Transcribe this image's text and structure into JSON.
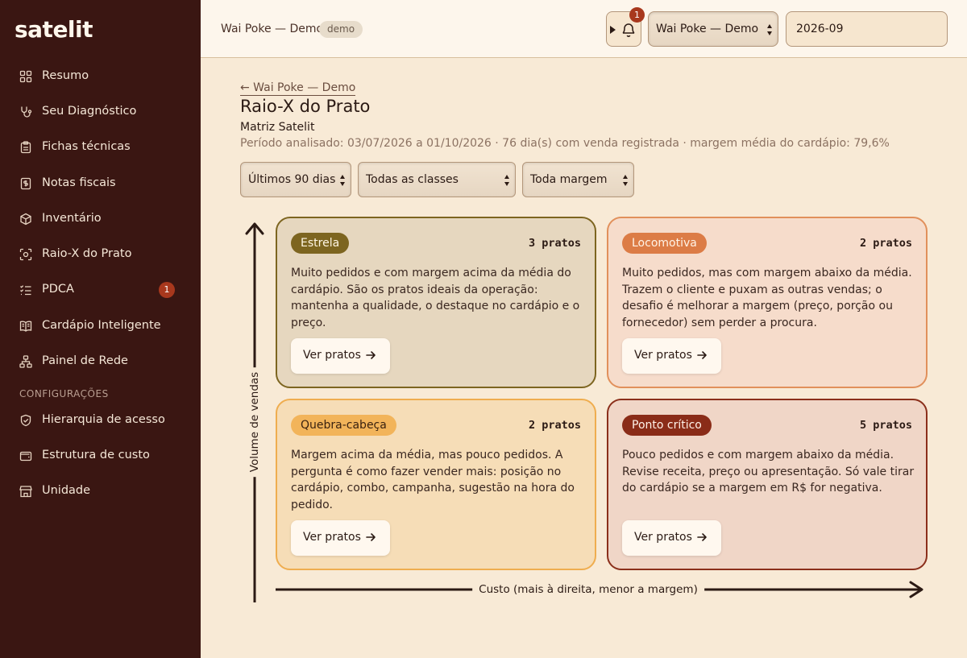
{
  "app": {
    "logo": "satelit"
  },
  "sidebar": {
    "items": [
      {
        "label": "Resumo",
        "icon": "grid-icon"
      },
      {
        "label": "Seu Diagnóstico",
        "icon": "stethoscope-icon"
      },
      {
        "label": "Fichas técnicas",
        "icon": "clipboard-icon"
      },
      {
        "label": "Notas fiscais",
        "icon": "receipt-icon"
      },
      {
        "label": "Inventário",
        "icon": "box-icon"
      },
      {
        "label": "Raio-X do Prato",
        "icon": "scan-icon"
      },
      {
        "label": "PDCA",
        "icon": "checklist-icon",
        "badge": "1"
      },
      {
        "label": "Cardápio Inteligente",
        "icon": "book-icon"
      },
      {
        "label": "Painel de Rede",
        "icon": "network-icon"
      }
    ],
    "section_label": "CONFIGURAÇÕES",
    "config_items": [
      {
        "label": "Hierarquia de acesso",
        "icon": "shield-icon"
      },
      {
        "label": "Estrutura de custo",
        "icon": "wallet-icon"
      },
      {
        "label": "Unidade",
        "icon": "store-icon"
      }
    ]
  },
  "topbar": {
    "org_name": "Wai Poke — Demo",
    "badge": "demo",
    "notification_count": "1",
    "org_select_value": "Wai Poke — Demo",
    "month_value": "2026-09"
  },
  "main": {
    "back_link": "← Wai Poke — Demo",
    "title": "Raio-X do Prato",
    "subtitle": "Matriz Satelit",
    "period": "Período analisado: 03/07/2026 a 01/10/2026 · 76 dia(s) com venda registrada · margem média do cardápio: 79,6%",
    "filters": {
      "period": "Últimos 90 dias",
      "class": "Todas as classes",
      "margin": "Toda margem"
    },
    "axes": {
      "y_label": "Volume de vendas",
      "x_label": "Custo (mais à direita, menor a margem)"
    },
    "quadrants": {
      "estrela": {
        "name": "Estrela",
        "count": "3 pratos",
        "description": "Muito pedidos e com margem acima da média do cardápio. São os pratos ideais da operação: mantenha a qualidade, o destaque no cardápio e o preço.",
        "button": "Ver pratos"
      },
      "locomotiva": {
        "name": "Locomotiva",
        "count": "2 pratos",
        "description": "Muito pedidos, mas com margem abaixo da média. Trazem o cliente e puxam as outras vendas; o desafio é melhorar a margem (preço, porção ou fornecedor) sem perder a procura.",
        "button": "Ver pratos"
      },
      "quebra_cabeca": {
        "name": "Quebra-cabeça",
        "count": "2 pratos",
        "description": "Margem acima da média, mas pouco pedidos. A pergunta é como fazer vender mais: posição no cardápio, combo, campanha, sugestão na hora do pedido.",
        "button": "Ver pratos"
      },
      "ponto_critico": {
        "name": "Ponto crítico",
        "count": "5 pratos",
        "description": "Pouco pedidos e com margem abaixo da média. Revise receita, preço ou apresentação. Só vale tirar do cardápio se a margem em R$ for negativa.",
        "button": "Ver pratos"
      }
    }
  }
}
